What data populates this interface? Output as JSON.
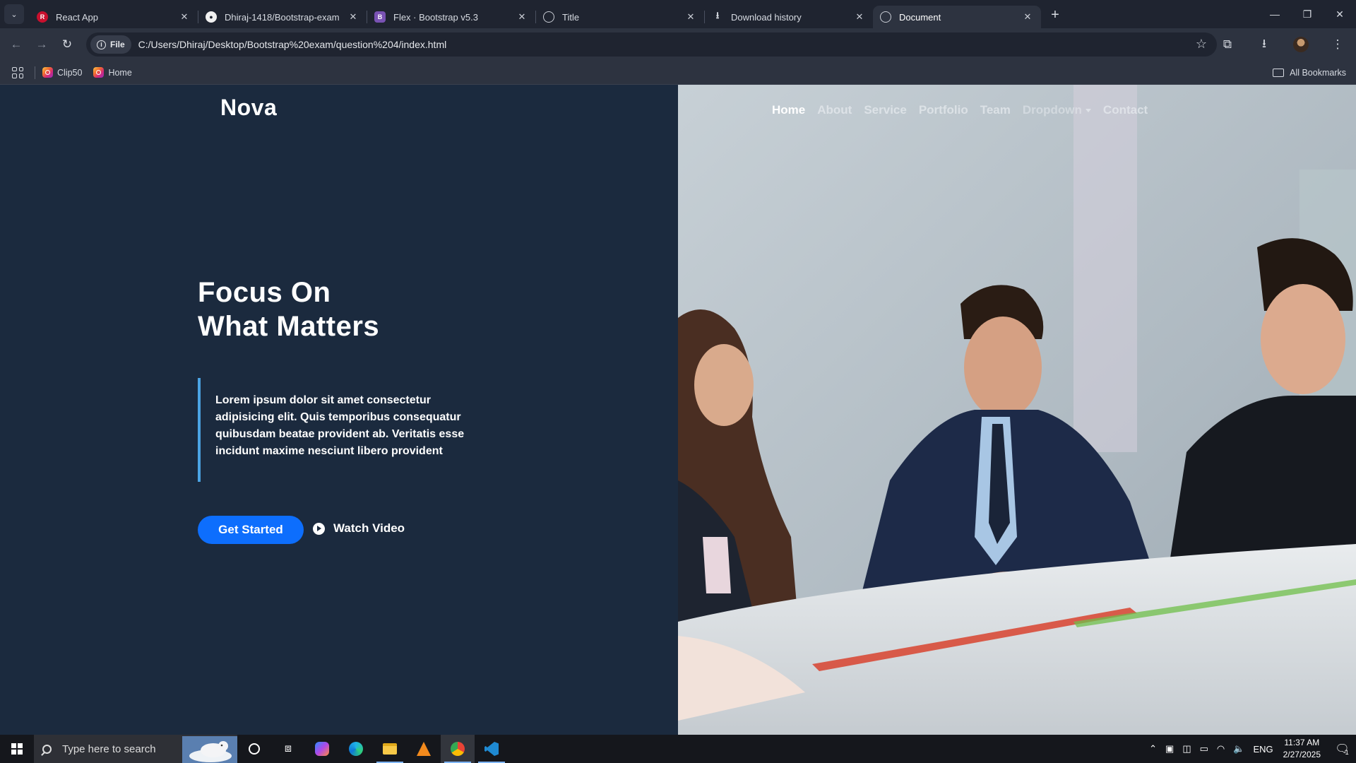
{
  "browser": {
    "tabs": [
      {
        "label": "React App",
        "favicon": "react-app-icon",
        "active": false
      },
      {
        "label": "Dhiraj-1418/Bootstrap-exam",
        "favicon": "github-icon",
        "active": false
      },
      {
        "label": "Flex · Bootstrap v5.3",
        "favicon": "bootstrap-icon",
        "active": false
      },
      {
        "label": "Title",
        "favicon": "globe-icon",
        "active": false
      },
      {
        "label": "Download history",
        "favicon": "download-icon",
        "active": false
      },
      {
        "label": "Document",
        "favicon": "globe-icon",
        "active": true
      }
    ],
    "address": {
      "chip_label": "File",
      "url": "C:/Users/Dhiraj/Desktop/Bootstrap%20exam/question%204/index.html"
    },
    "bookmarks": [
      {
        "label": "Clip50",
        "icon": "instagram-icon"
      },
      {
        "label": "Home",
        "icon": "instagram-icon"
      }
    ],
    "all_bookmarks_label": "All Bookmarks"
  },
  "site": {
    "brand": "Nova",
    "nav": [
      {
        "label": "Home",
        "active": true
      },
      {
        "label": "About"
      },
      {
        "label": "Service"
      },
      {
        "label": "Portfolio"
      },
      {
        "label": "Team"
      },
      {
        "label": "Dropdown",
        "has_caret": true
      },
      {
        "label": "Contact"
      }
    ],
    "hero": {
      "headline_line1": "Focus On",
      "headline_line2": "What Matters",
      "paragraph": "Lorem ipsum dolor sit amet consectetur adipisicing elit. Quis temporibus consequatur quibusdam beatae provident ab. Veritatis esse incidunt maxime nesciunt libero provident",
      "cta_label": "Get Started",
      "watch_label": "Watch Video"
    },
    "colors": {
      "background": "#1b2a3e",
      "primary": "#0d6efd",
      "quote_border": "#4ba3e3"
    }
  },
  "taskbar": {
    "search_placeholder": "Type here to search",
    "apps": [
      "task-view-icon",
      "copilot-icon",
      "edge-icon",
      "file-explorer-icon",
      "vlc-icon",
      "chrome-icon",
      "vscode-icon"
    ],
    "language": "ENG",
    "time": "11:37 AM",
    "date": "2/27/2025",
    "notification_count": "1"
  }
}
